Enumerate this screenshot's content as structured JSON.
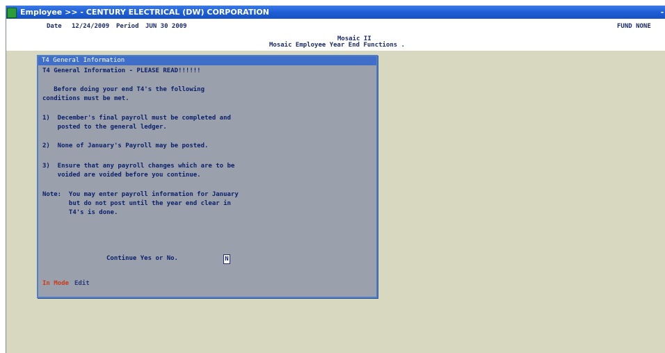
{
  "window": {
    "title": "Employee >> - CENTURY ELECTRICAL (DW) CORPORATION",
    "control_glyph": "-"
  },
  "header": {
    "date_label": "Date",
    "date_value": "12/24/2009",
    "period_label": "Period",
    "period_value": "JUN 30 2009",
    "module": "Mosaic II",
    "subtitle": "Mosaic Employee Year End Functions .",
    "fund": "FUND NONE"
  },
  "dialog": {
    "title": "T4 General Information",
    "lines": [
      "T4 General Information - PLEASE READ!!!!!!",
      "",
      "   Before doing your end T4's the following",
      "conditions must be met.",
      "",
      "1)  December's final payroll must be completed and",
      "    posted to the general ledger.",
      "",
      "2)  None of January's Payroll may be posted.",
      "",
      "3)  Ensure that any payroll changes which are to be",
      "    voided are voided before you continue.",
      "",
      "Note:  You may enter payroll information for January",
      "       but do not post until the year end clear in",
      "       T4's is done."
    ],
    "prompt_label": "Continue Yes or No.",
    "prompt_value": "N"
  },
  "status": {
    "mode_label": "In Mode",
    "mode_value": "Edit"
  }
}
